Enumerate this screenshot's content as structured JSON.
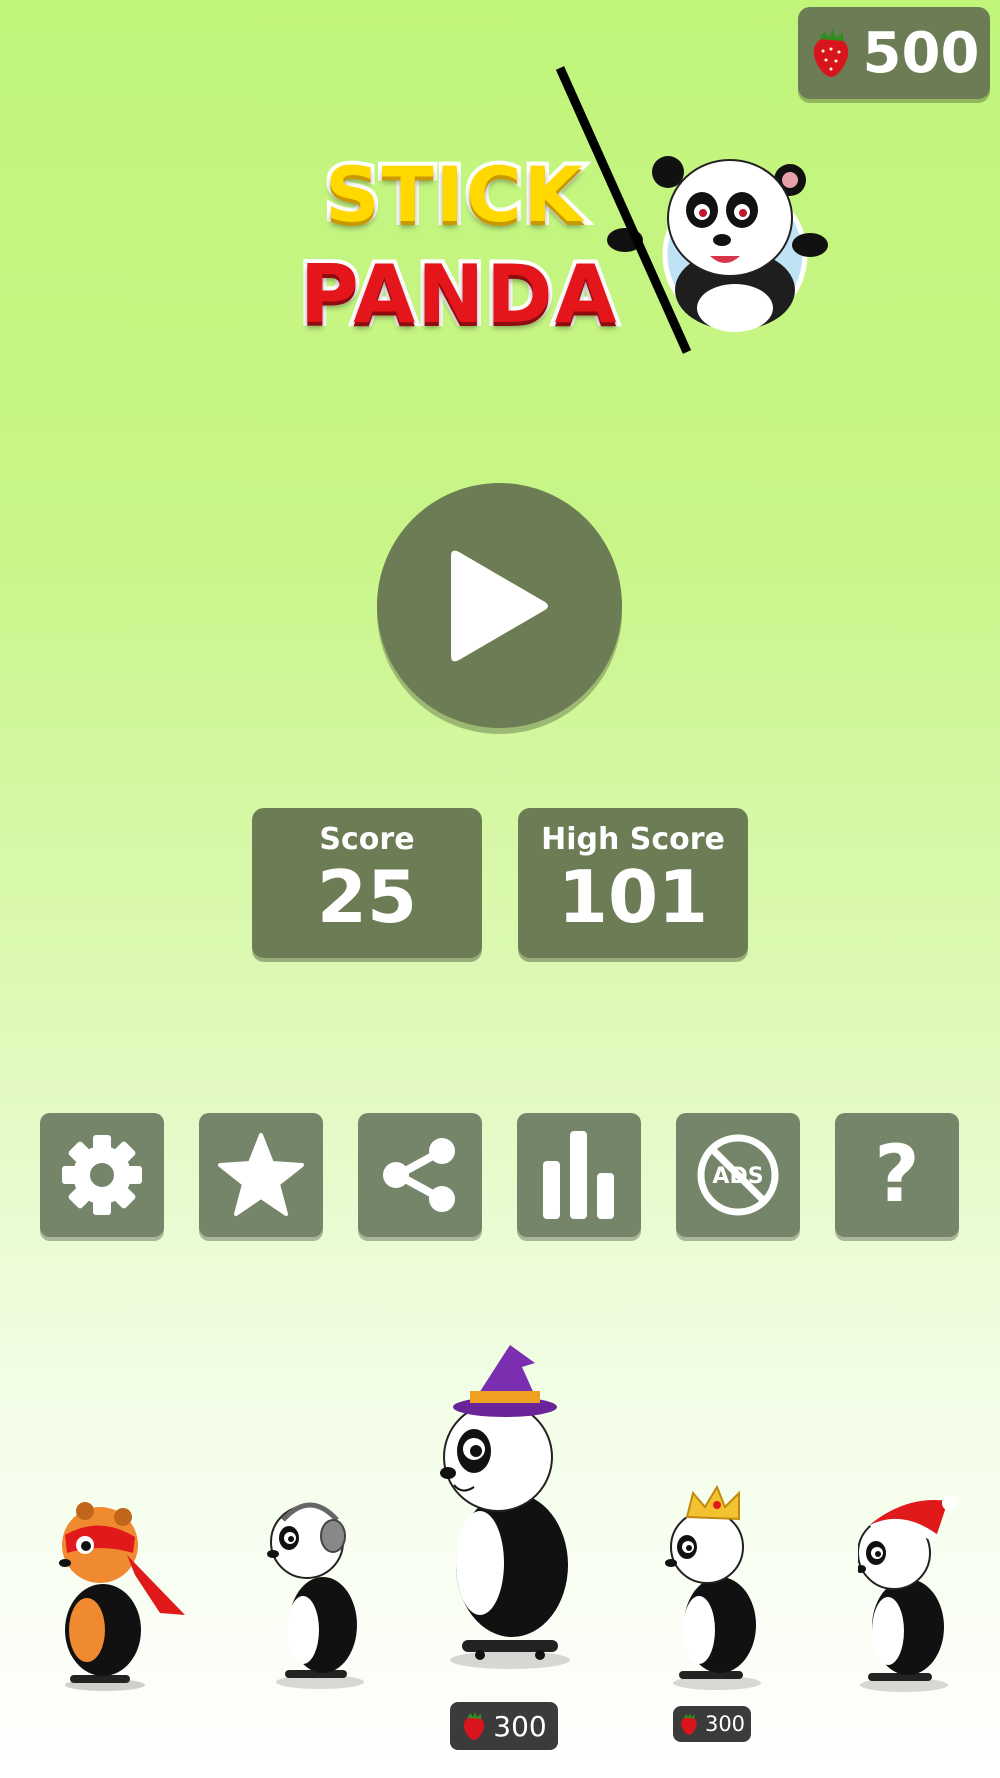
{
  "currency": {
    "icon": "strawberry-icon",
    "amount": "500"
  },
  "logo": {
    "line1": "STICK",
    "line2": "PANDA"
  },
  "play": {
    "icon": "play-icon"
  },
  "score": {
    "label": "Score",
    "value": "25"
  },
  "high_score": {
    "label": "High Score",
    "value": "101"
  },
  "toolbar": [
    {
      "name": "settings",
      "icon": "gear-icon"
    },
    {
      "name": "rate",
      "icon": "star-icon"
    },
    {
      "name": "share",
      "icon": "share-icon"
    },
    {
      "name": "leaderboard",
      "icon": "bar-chart-icon"
    },
    {
      "name": "remove-ads",
      "icon": "no-ads-icon",
      "text": "ADS"
    },
    {
      "name": "help",
      "icon": "question-icon",
      "text": "?"
    }
  ],
  "characters": [
    {
      "name": "ninja-panda",
      "accessory": "red-mask-icon"
    },
    {
      "name": "headphones-panda",
      "accessory": "headphones-icon"
    },
    {
      "name": "wizard-panda",
      "accessory": "wizard-hat-icon",
      "price": "300",
      "selected": true
    },
    {
      "name": "king-panda",
      "accessory": "crown-icon",
      "price": "300"
    },
    {
      "name": "santa-panda",
      "accessory": "santa-hat-icon"
    }
  ],
  "colors": {
    "panel": "#6c7c55",
    "button": "#75856a",
    "accent_red": "#e5161b",
    "accent_yellow": "#ffd800"
  }
}
